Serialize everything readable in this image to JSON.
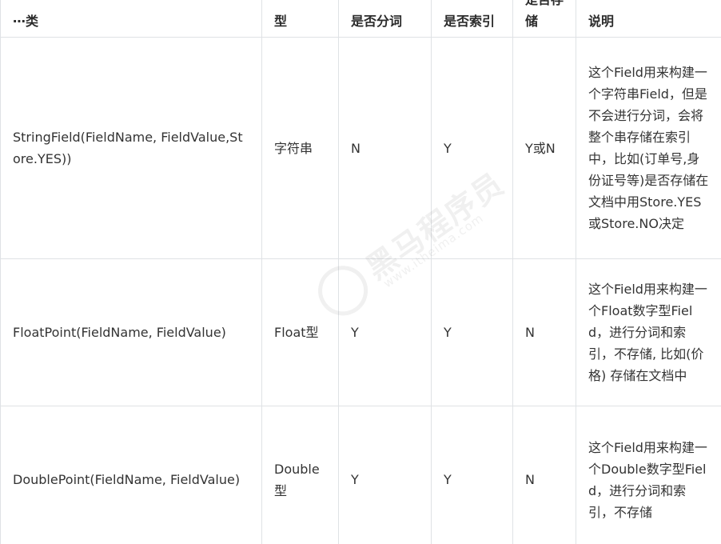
{
  "table": {
    "headers": [
      "Field类",
      "数据类型",
      "是否分词",
      "是否索引",
      "是否存储",
      "说明"
    ],
    "header_display": [
      "⋯类",
      "型",
      "是否分词",
      "是否索引",
      "是否存储",
      "说明"
    ],
    "rows": [
      {
        "field_class": "StringField(FieldName, FieldValue,Store.YES))",
        "data_type": "字符串",
        "tokenized": "N",
        "indexed": "Y",
        "stored": "Y或N",
        "description": "这个Field用来构建一个字符串Field，但是不会进行分词，会将整个串存储在索引中，比如(订单号,身份证号等)是否存储在文档中用Store.YES或Store.NO决定"
      },
      {
        "field_class": "FloatPoint(FieldName, FieldValue)",
        "data_type": "Float型",
        "tokenized": "Y",
        "indexed": "Y",
        "stored": "N",
        "description": "这个Field用来构建一个Float数字型Field，进行分词和索引，不存储, 比如(价格) 存储在文档中"
      },
      {
        "field_class": "DoublePoint(FieldName, FieldValue)",
        "data_type": "Double型",
        "tokenized": "Y",
        "indexed": "Y",
        "stored": "N",
        "description": "这个Field用来构建一个Double数字型Field，进行分词和索引，不存储"
      }
    ]
  },
  "watermark": {
    "brand": "黑马程序员",
    "url": "www.itheima.com"
  }
}
